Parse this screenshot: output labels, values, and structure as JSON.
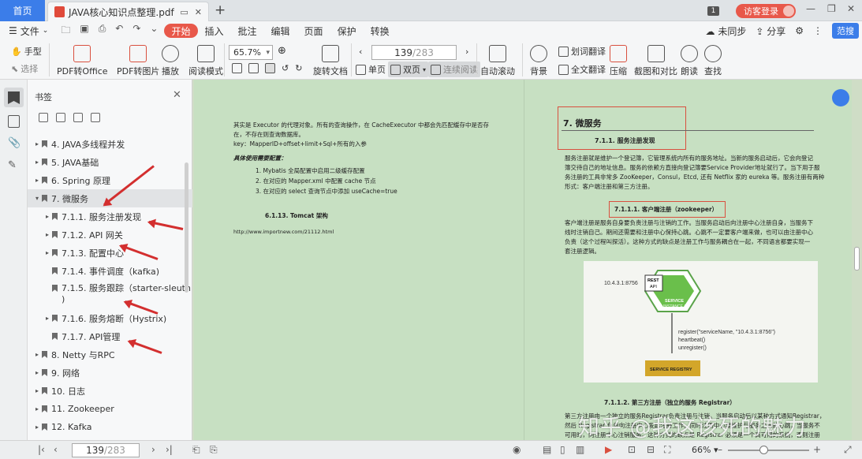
{
  "titlebar": {
    "home_tab": "首页",
    "doc_tab": "JAVA核心知识点整理.pdf",
    "new_tab": "+",
    "page_badge": "1",
    "login": "访客登录"
  },
  "menubar": {
    "file": "文件",
    "tabs": [
      "开始",
      "插入",
      "批注",
      "编辑",
      "页面",
      "保护",
      "转换"
    ],
    "active_tab": "开始",
    "unsync": "未同步",
    "share": "分享",
    "top_right": "范搜"
  },
  "ribbon": {
    "hand": "手型",
    "select": "选择",
    "pdf_to_office": "PDF转Office",
    "pdf_to_image": "PDF转图片",
    "play": "播放",
    "read_mode": "阅读模式",
    "zoom": "65.7%",
    "rotate_doc": "旋转文档",
    "single_page": "单页",
    "double_page": "双页",
    "continuous": "连续阅读",
    "page_current": "139",
    "page_total": "/283",
    "auto_scroll": "自动滚动",
    "background": "背景",
    "word_translate": "划词翻译",
    "full_translate": "全文翻译",
    "compress": "压缩",
    "screenshot_compare": "截图和对比",
    "read_aloud": "朗读",
    "find": "查找"
  },
  "panel": {
    "title": "书签",
    "items": [
      {
        "label": "4. JAVA多线程并发",
        "level": 0,
        "expand": "▸"
      },
      {
        "label": "5. JAVA基础",
        "level": 0,
        "expand": "▸"
      },
      {
        "label": "6. Spring 原理",
        "level": 0,
        "expand": "▸"
      },
      {
        "label": "7.   微服务",
        "level": 0,
        "expand": "▾"
      },
      {
        "label": "7.1.1. 服务注册发现",
        "level": 1,
        "expand": "▸"
      },
      {
        "label": "7.1.2. API 网关",
        "level": 1,
        "expand": "▸"
      },
      {
        "label": "7.1.3. 配置中心",
        "level": 1,
        "expand": "▸"
      },
      {
        "label": "7.1.4. 事件调度（kafka)",
        "level": 1,
        "expand": ""
      },
      {
        "label": "7.1.5. 服务跟踪（starter-sleuth",
        "label2": ")",
        "level": 1,
        "expand": ""
      },
      {
        "label": "7.1.6. 服务熔断（Hystrix)",
        "level": 1,
        "expand": "▸"
      },
      {
        "label": "7.1.7. API管理",
        "level": 1,
        "expand": ""
      },
      {
        "label": "8. Netty 与RPC",
        "level": 0,
        "expand": "▸"
      },
      {
        "label": "9. 网络",
        "level": 0,
        "expand": "▸"
      },
      {
        "label": "10. 日志",
        "level": 0,
        "expand": "▸"
      },
      {
        "label": "11. Zookeeper",
        "level": 0,
        "expand": "▸"
      },
      {
        "label": "12. Kafka",
        "level": 0,
        "expand": "▸"
      }
    ]
  },
  "left_page": {
    "p1": "其实是 Executor 的代理对象。所有的查询操作，在 CacheExecutor 中都会先匹配缓存中是否存",
    "p2": "在，不存在则查询数据库。",
    "p3": "key：MapperID+offset+limit+Sql+所有的入参",
    "config_title": "具体使用需要配置：",
    "list": [
      "1.     Mybatis 全局配置中启用二级缓存配置",
      "2.     在对应的 Mapper.xml 中配置 cache 节点",
      "3.     在对应的 select 查询节点中添加 useCache=true"
    ],
    "tomcat_heading": "6.1.13.     Tomcat 架构",
    "url": "http://www.importnew.com/21112.html"
  },
  "right_page": {
    "h1": "7.   微服务",
    "h2": "7.1.1.  服务注册发现",
    "para1": [
      "服务注册就是维护一个登记簿，它管理系统内所有的服务地址。当新的服务启动后，它会向登记",
      "簿交待自己的地址信息。服务的依赖方直接向登记簿要Service Provider地址就行了。当下用于服",
      "务注册的工具非常多 ZooKeeper，Consul，Etcd, 还有 Netflix 家的 eureka 等。服务注册有两种",
      "形式：客户端注册和第三方注册。"
    ],
    "h3": "7.1.1.1.     客户端注册（zookeeper）",
    "para2": [
      "客户端注册是服务自身要负责注册与注销的工作。当服务启动后向注册中心注册自身，当服务下",
      "线时注销自己。期间还需要和注册中心保持心跳。心跳不一定要客户端来做，也可以由注册中心",
      "负责（这个过程叫探活）。这种方式的缺点是注册工作与服务耦合在一起，不同语言都要实现一",
      "套注册逻辑。"
    ],
    "diagram": {
      "ip": "10.4.3.1:8756",
      "rest": "REST",
      "api": "API",
      "service": "SERVICE",
      "instance": "INSTANCE A",
      "code1": "register(\"serviceName, \"10.4.3.1:8756\")",
      "code2": "heartbeat()",
      "code3": "unregister()",
      "registry": "SERVICE REGISTRY"
    },
    "h4": "7.1.1.2.     第三方注册（独立的服务 Registrar）",
    "tail1": "第三方注册由一个独立的服务Registrar负责注册与注销。当服务启动后以某种方式通知Registrar，",
    "tail2": "然后 Registrar 负责向注册中心发起注册工作。同时注册中心要维护与服务之间的心跳，当服务不",
    "tail3": "可用时，向注册中心注销服务。这种方式的缺点是 Registrar 必须是一个高可用的系统，否则注册"
  },
  "watermark": "知乎 @我这该死的魅力",
  "statusbar": {
    "page_current": "139",
    "page_total": "/283",
    "zoom": "66%",
    "zoom_fraction": 0.4
  }
}
